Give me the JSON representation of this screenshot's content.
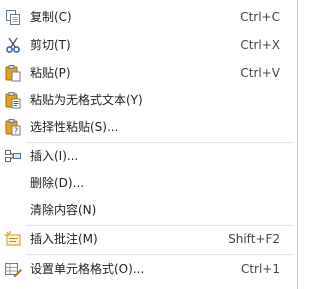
{
  "menu": {
    "items": [
      {
        "label": "复制(C)",
        "shortcut": "Ctrl+C",
        "icon": "copy-icon"
      },
      {
        "label": "剪切(T)",
        "shortcut": "Ctrl+X",
        "icon": "scissors-icon"
      },
      {
        "label": "粘贴(P)",
        "shortcut": "Ctrl+V",
        "icon": "paste-icon"
      },
      {
        "label": "粘贴为无格式文本(Y)",
        "shortcut": "",
        "icon": "paste-text-icon"
      },
      {
        "label": "选择性粘贴(S)...",
        "shortcut": "",
        "icon": "paste-special-icon"
      },
      {
        "label": "插入(I)...",
        "shortcut": "",
        "icon": "insert-icon"
      },
      {
        "label": "删除(D)...",
        "shortcut": "",
        "icon": ""
      },
      {
        "label": "清除内容(N)",
        "shortcut": "",
        "icon": ""
      },
      {
        "label": "插入批注(M)",
        "shortcut": "Shift+F2",
        "icon": "insert-comment-icon"
      },
      {
        "label": "设置单元格格式(O)...",
        "shortcut": "Ctrl+1",
        "icon": "format-cells-icon"
      }
    ]
  }
}
